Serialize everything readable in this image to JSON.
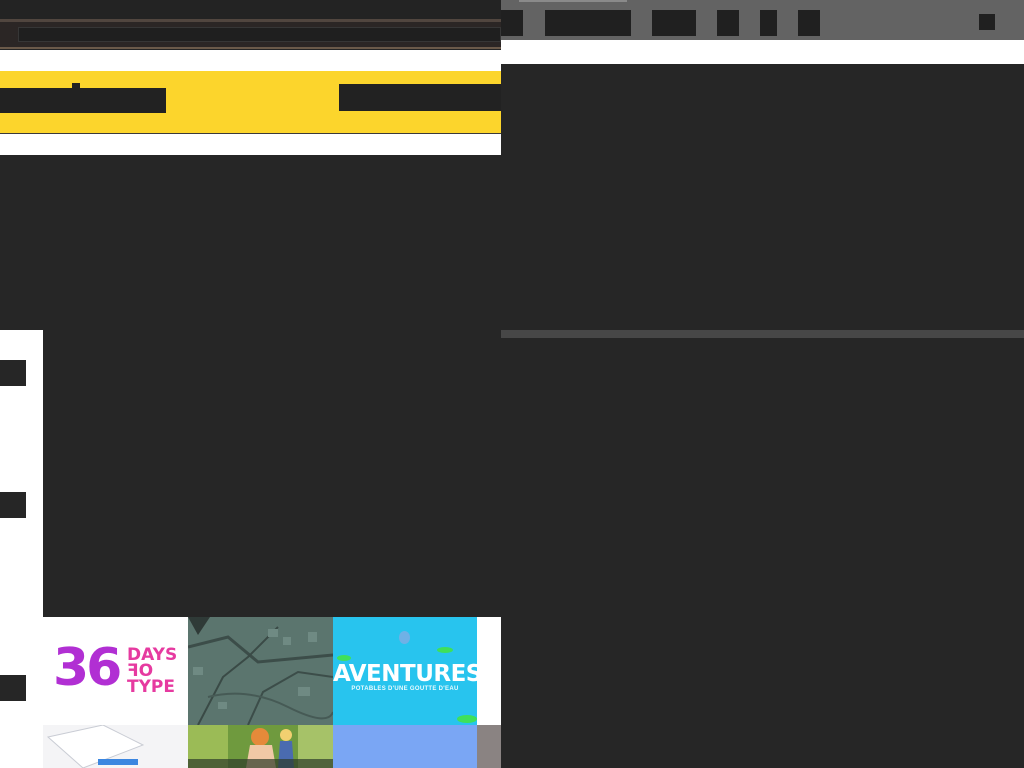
{
  "gallery": {
    "tiles": [
      {
        "name": "36 days of type",
        "num": "36",
        "words": [
          "DAYS",
          "OF",
          "TYPE"
        ],
        "num_color": "#b12fd3",
        "word_color": "#e63aa0"
      },
      {
        "name": "map",
        "icon": "city-map-image"
      },
      {
        "name": "aventures",
        "title": "AVENTURES",
        "subtitle": "POTABLES D'UNE GOUTTE D'EAU",
        "bg": "#28c4ee"
      },
      {
        "name": "phone",
        "icon": "phone-mockup-image"
      },
      {
        "name": "photo",
        "icon": "illustration-photo-image"
      },
      {
        "name": "blue",
        "bg": "#7aa6f4"
      }
    ]
  },
  "colors": {
    "site_header": "#fcd52c",
    "background": "#262626",
    "right_toolbar": "#636363"
  }
}
